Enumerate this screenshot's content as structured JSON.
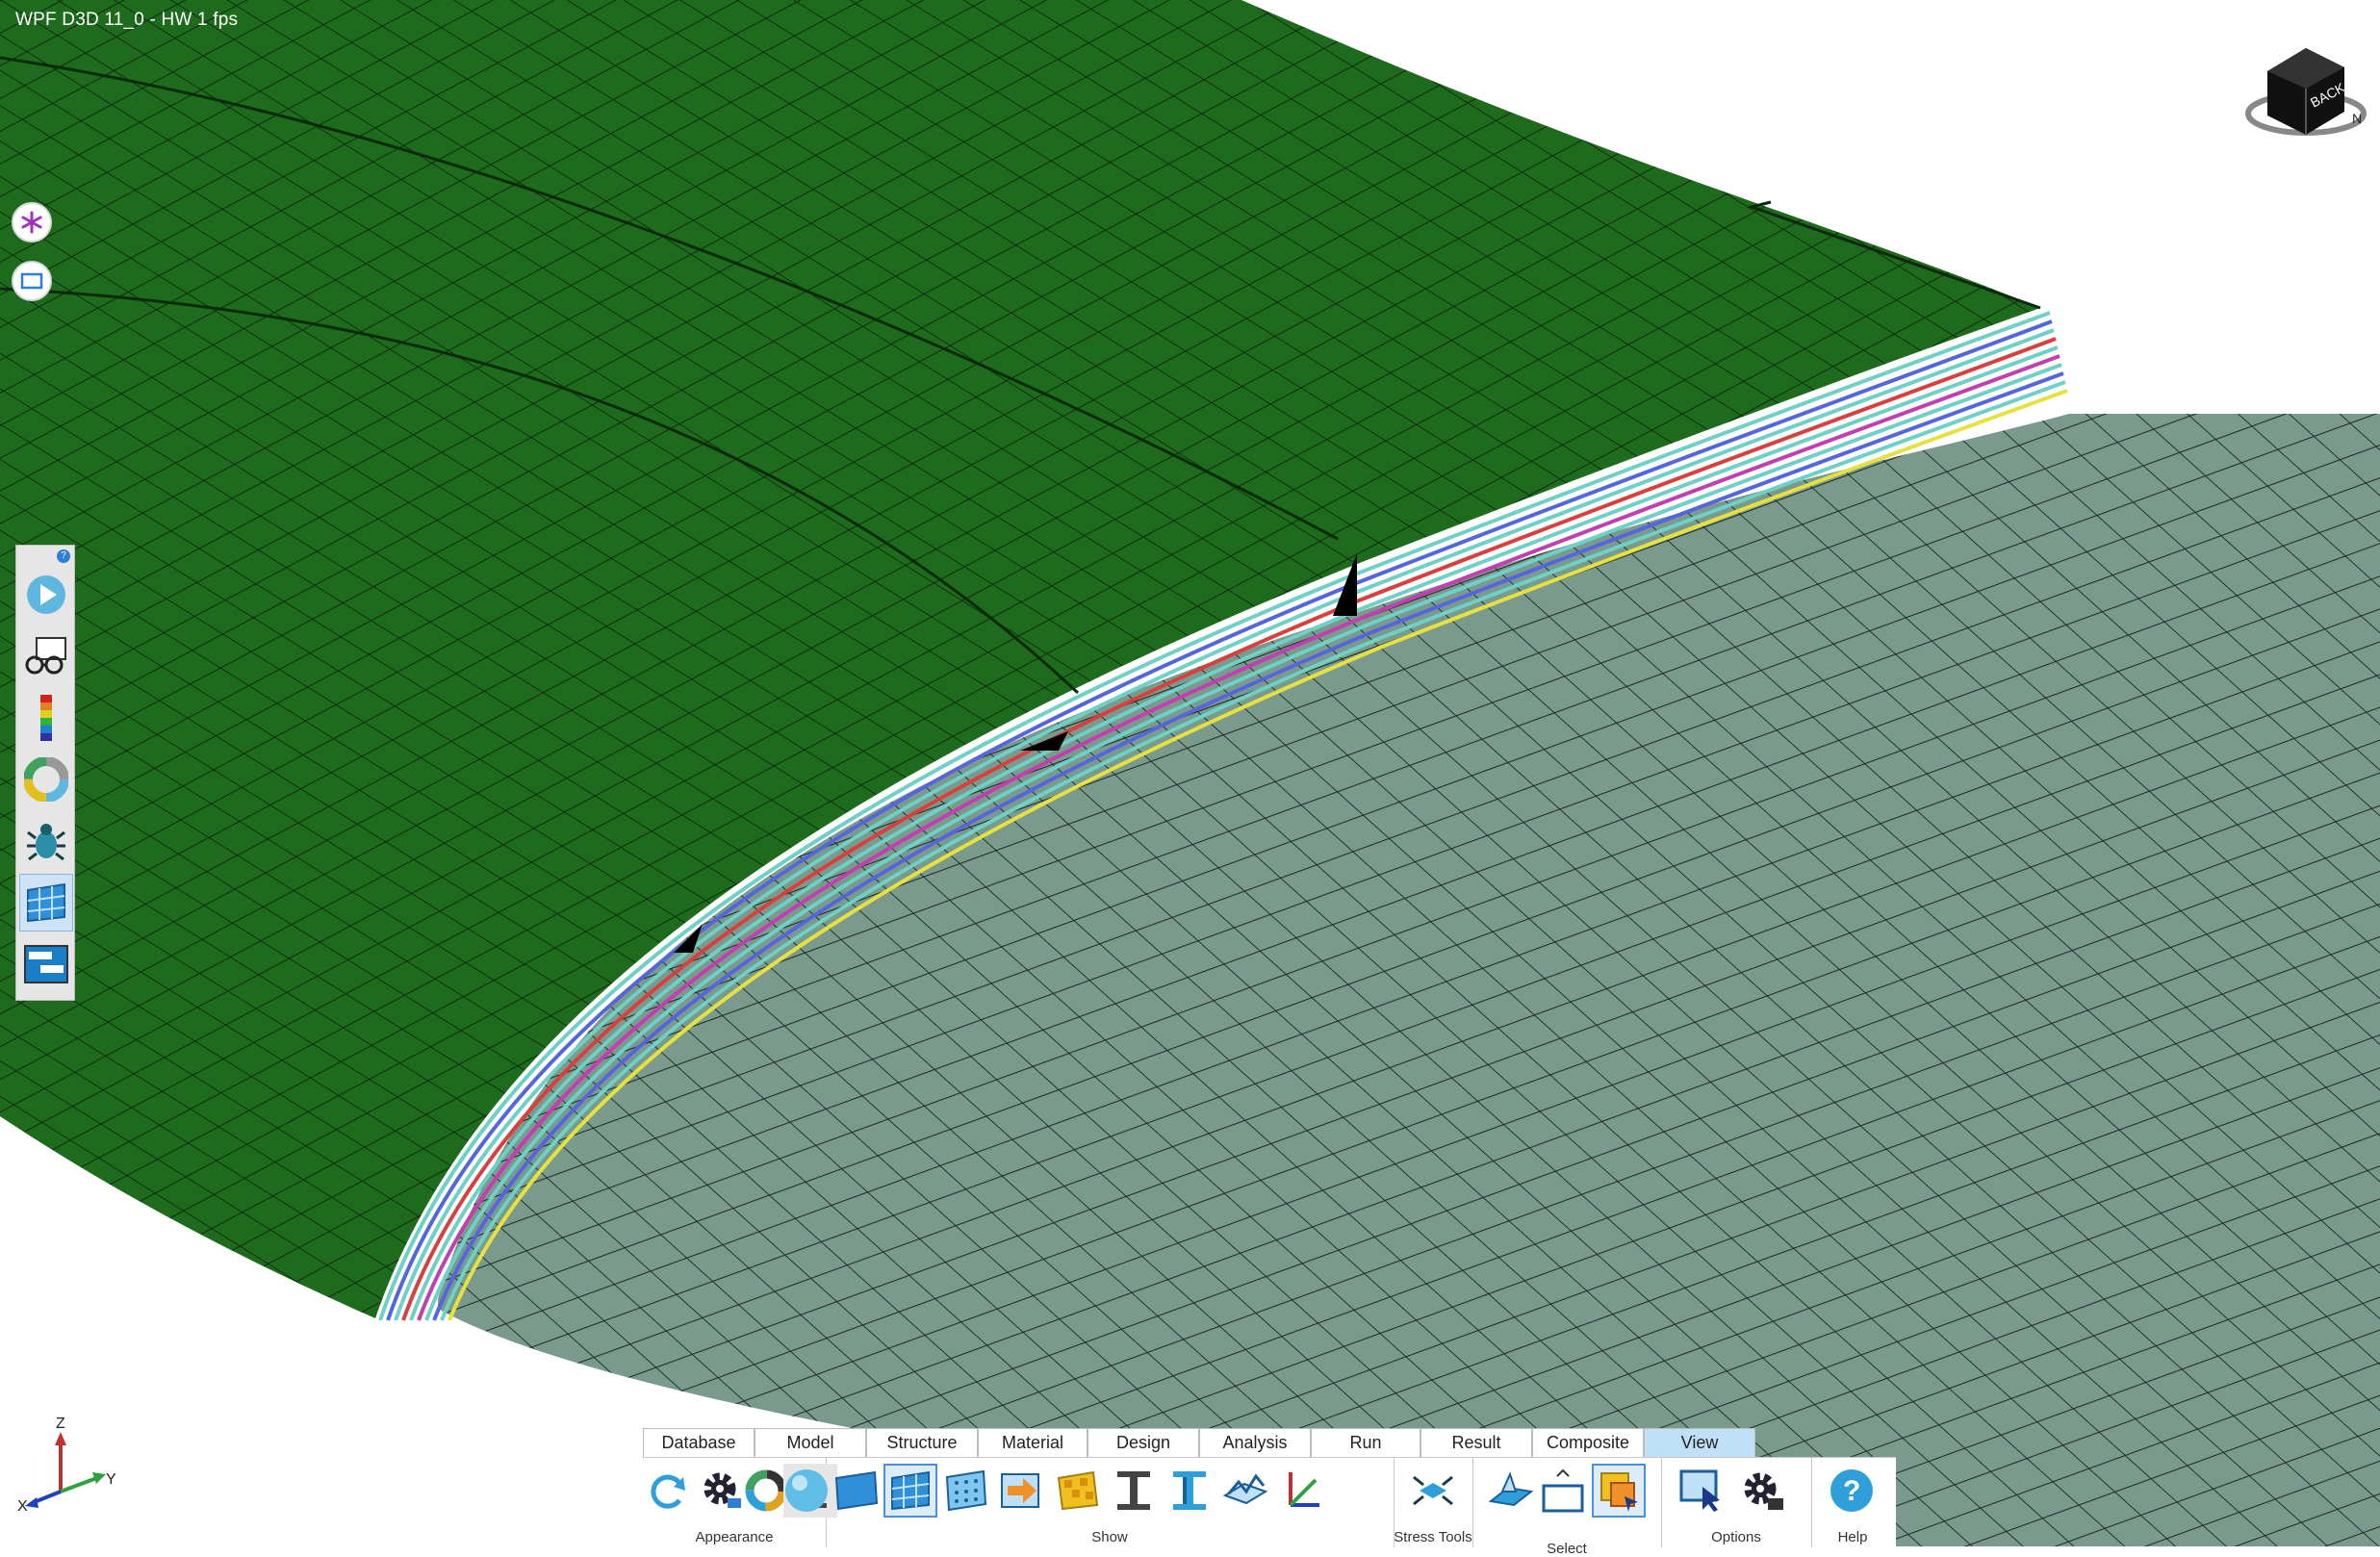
{
  "window": {
    "title": "WPF D3D 11_0 - HW   1 fps"
  },
  "floating_buttons": [
    {
      "name": "explode-icon"
    },
    {
      "name": "frame-icon"
    }
  ],
  "side_toolbar": {
    "help_badge": "?",
    "items": [
      {
        "name": "play-animation-icon"
      },
      {
        "name": "glasses-view-icon"
      },
      {
        "name": "color-legend-icon"
      },
      {
        "name": "color-wheel-icon"
      },
      {
        "name": "bug-icon"
      },
      {
        "name": "mesh-grid-icon"
      },
      {
        "name": "panel-list-icon"
      }
    ],
    "active_index": 5
  },
  "ribbon": {
    "tabs": [
      "Database",
      "Model",
      "Structure",
      "Material",
      "Design",
      "Analysis",
      "Run",
      "Result",
      "Composite",
      "View"
    ],
    "active_tab": "View",
    "groups": {
      "appearance": "Appearance",
      "show": "Show",
      "stress_tools": "Stress Tools",
      "select": "Select",
      "options": "Options",
      "help": "Help"
    }
  },
  "axis": {
    "x": "X",
    "y": "Y",
    "z": "Z"
  },
  "view_cube": {
    "face_label": "BACK",
    "compass_label": "N"
  },
  "colors": {
    "skin_green": "#1f6b1e",
    "core_gray": "#7a9a8e",
    "mesh_line": "#0a1a0a",
    "ply_cyan": "#6fd0c6",
    "ply_red": "#d84040",
    "ply_blue": "#5566dd",
    "ply_magenta": "#c040b0",
    "accent_blue": "#2e7fd1"
  }
}
